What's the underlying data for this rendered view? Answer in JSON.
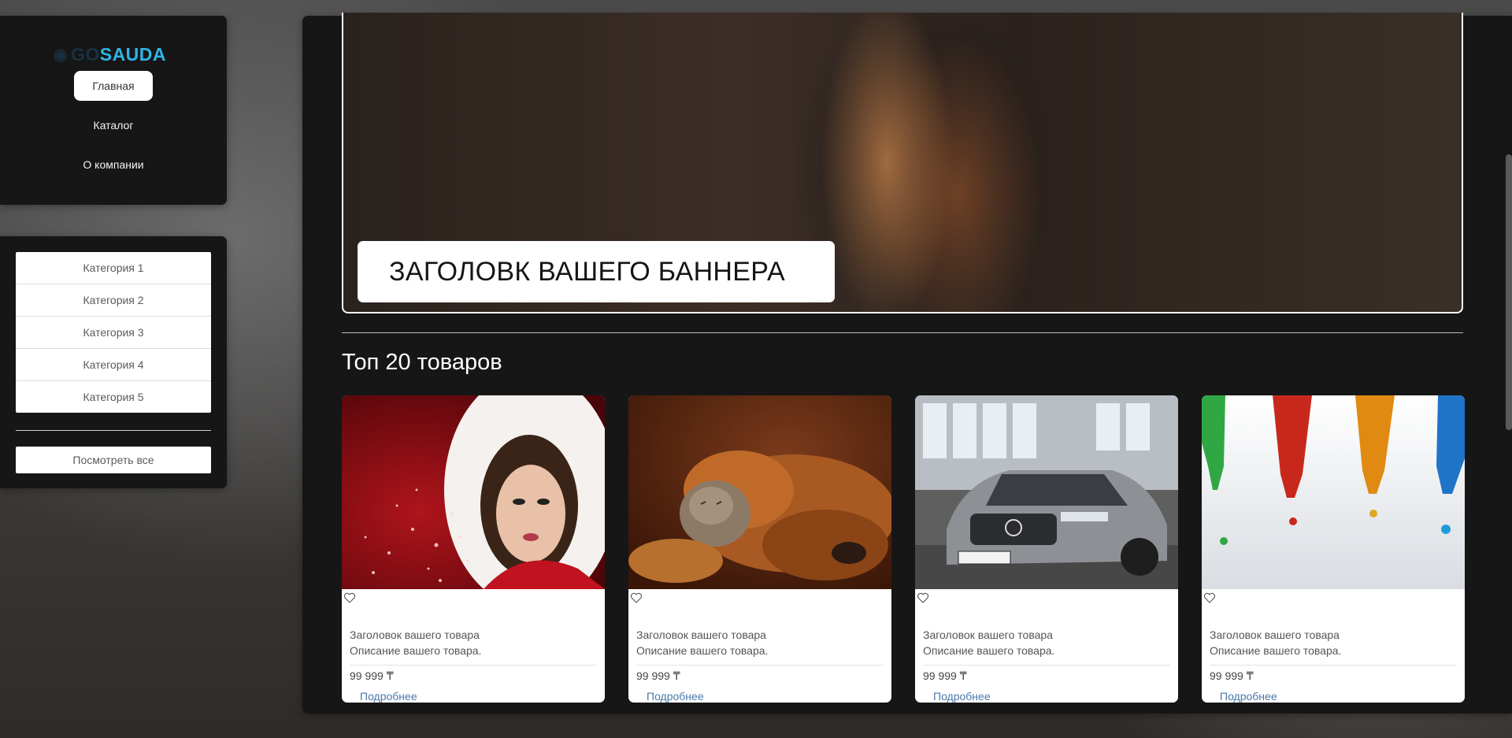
{
  "logo": {
    "part1": "GO",
    "part2": "SAUDA"
  },
  "nav": {
    "items": [
      {
        "label": "Главная",
        "active": true
      },
      {
        "label": "Каталог",
        "active": false
      },
      {
        "label": "О компании",
        "active": false
      }
    ]
  },
  "categories": {
    "items": [
      "Категория 1",
      "Категория 2",
      "Категория 3",
      "Категория 4",
      "Категория 5"
    ],
    "view_all": "Посмотреть все"
  },
  "banner": {
    "title": "ЗАГОЛОВК ВАШЕГО БАННЕРА"
  },
  "section": {
    "title": "Топ 20 товаров"
  },
  "products": [
    {
      "title": "Заголовок вашего товара",
      "description": "Описание вашего товара.",
      "price": "99 999 ₸",
      "more": "Подробнее",
      "image": "woman-in-santa-hood"
    },
    {
      "title": "Заголовок вашего товара",
      "description": "Описание вашего товара.",
      "price": "99 999 ₸",
      "more": "Подробнее",
      "image": "dog-and-kitten"
    },
    {
      "title": "Заголовок вашего товара",
      "description": "Описание вашего товара.",
      "price": "99 999 ₸",
      "more": "Подробнее",
      "image": "silver-car"
    },
    {
      "title": "Заголовок вашего товара",
      "description": "Описание вашего товара.",
      "price": "99 999 ₸",
      "more": "Подробнее",
      "image": "colored-bottles"
    }
  ],
  "colors": {
    "accent": "#2fb5e8",
    "panel": "#161616",
    "link": "#4a78aa"
  }
}
